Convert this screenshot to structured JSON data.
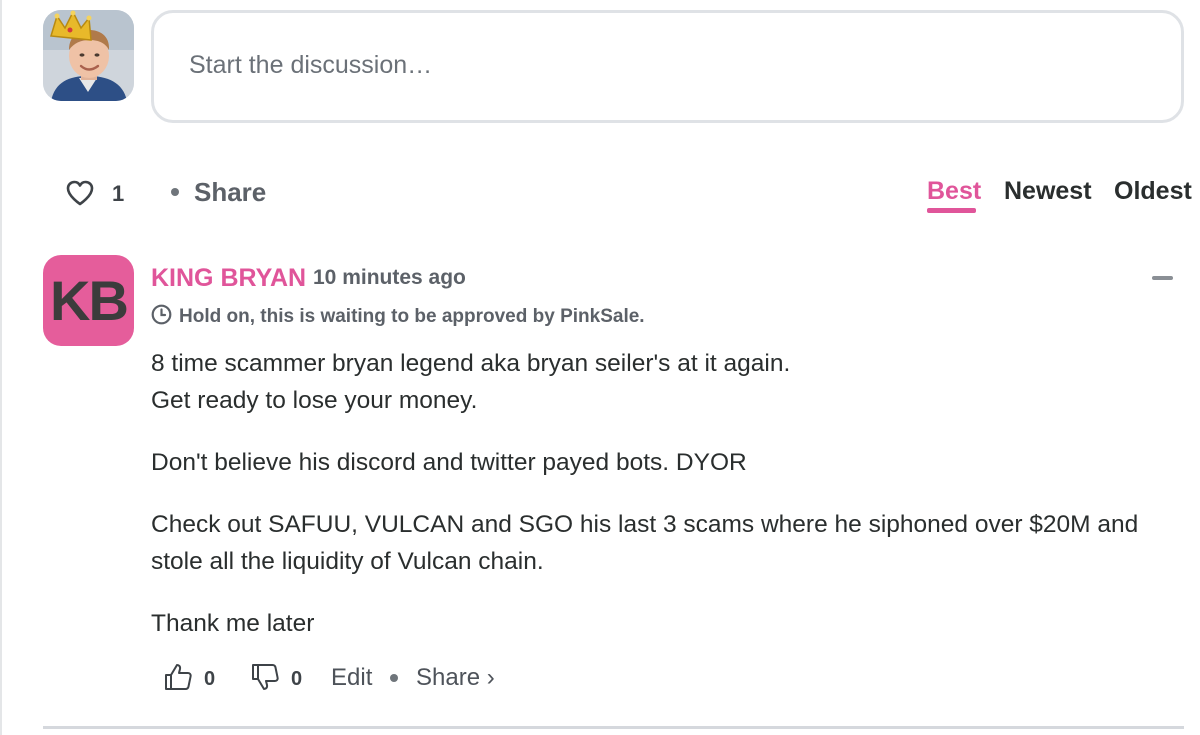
{
  "compose": {
    "placeholder": "Start the discussion…"
  },
  "thread_toolbar": {
    "like_count": "1",
    "share_label": "Share",
    "sort_tabs": [
      "Best",
      "Newest",
      "Oldest"
    ],
    "active_sort": "Best"
  },
  "comment": {
    "avatar_initials": "KB",
    "author": "KING BRYAN",
    "timestamp": "10 minutes ago",
    "pending_notice": "Hold on, this is waiting to be approved by PinkSale.",
    "body_lines": [
      "8 time scammer bryan legend aka bryan seiler's at it again.",
      "Get ready to lose your money.",
      "Don't believe his discord and twitter payed bots. DYOR",
      "Check out SAFUU, VULCAN and SGO his last 3 scams where he siphoned over $20M and",
      "stole all the liquidity of Vulcan chain.",
      "Thank me later"
    ],
    "upvotes": "0",
    "downvotes": "0",
    "edit_label": "Edit",
    "share_label": "Share ›"
  },
  "colors": {
    "accent_pink": "#e0559a",
    "avatar_pink": "#e55d9b",
    "text_dark": "#2a2e2e",
    "text_muted": "#5c6168"
  },
  "icons": [
    "heart-icon",
    "clock-icon",
    "thumbs-up-icon",
    "thumbs-down-icon",
    "collapse-icon"
  ]
}
